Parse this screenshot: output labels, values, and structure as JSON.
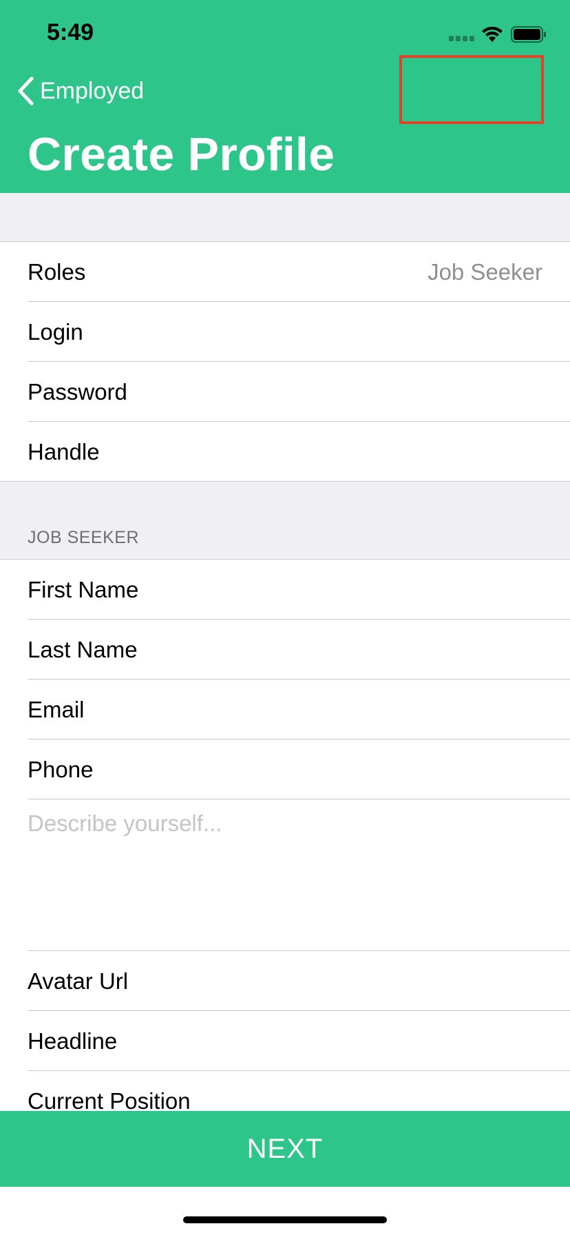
{
  "status_bar": {
    "time": "5:49"
  },
  "nav": {
    "back_label": "Employed",
    "title": "Create Profile"
  },
  "account_section": {
    "rows": [
      {
        "label": "Roles",
        "value": "Job Seeker"
      },
      {
        "label": "Login",
        "value": ""
      },
      {
        "label": "Password",
        "value": ""
      },
      {
        "label": "Handle",
        "value": ""
      }
    ]
  },
  "job_seeker_section": {
    "header": "JOB SEEKER",
    "rows_before": [
      {
        "label": "First Name"
      },
      {
        "label": "Last Name"
      },
      {
        "label": "Email"
      },
      {
        "label": "Phone"
      }
    ],
    "description_placeholder": "Describe yourself...",
    "rows_after": [
      {
        "label": "Avatar Url"
      },
      {
        "label": "Headline"
      },
      {
        "label": "Current Position"
      }
    ]
  },
  "footer": {
    "next_label": "NEXT"
  },
  "colors": {
    "accent": "#2ec58a",
    "highlight": "#e0422a",
    "group_bg": "#efeff4"
  }
}
